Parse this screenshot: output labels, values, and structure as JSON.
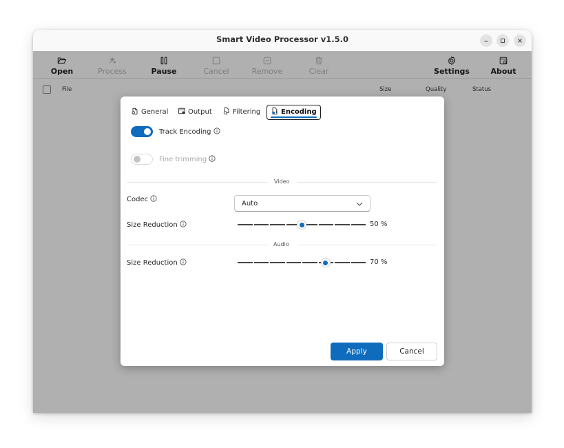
{
  "window": {
    "title": "Smart Video Processor v1.5.0"
  },
  "toolbar": {
    "items": [
      {
        "label": "Open",
        "icon": "folder-open-icon",
        "enabled": true
      },
      {
        "label": "Process",
        "icon": "process-icon",
        "enabled": false
      },
      {
        "label": "Pause",
        "icon": "pause-icon",
        "enabled": true
      },
      {
        "label": "Cancel",
        "icon": "stop-icon",
        "enabled": false
      },
      {
        "label": "Remove",
        "icon": "remove-icon",
        "enabled": false
      },
      {
        "label": "Clear",
        "icon": "trash-icon",
        "enabled": false
      },
      {
        "label": "Settings",
        "icon": "gear-icon",
        "enabled": true
      },
      {
        "label": "About",
        "icon": "about-icon",
        "enabled": true
      }
    ]
  },
  "file_list": {
    "columns": [
      "File",
      "Size",
      "Quality",
      "Status"
    ]
  },
  "dialog": {
    "tabs": [
      {
        "label": "General",
        "icon": "general-icon",
        "active": false
      },
      {
        "label": "Output",
        "icon": "output-icon",
        "active": false
      },
      {
        "label": "Filtering",
        "icon": "filtering-icon",
        "active": false
      },
      {
        "label": "Encoding",
        "icon": "encoding-icon",
        "active": true
      }
    ],
    "track_encoding": {
      "label": "Track Encoding",
      "on": true
    },
    "fine_trimming": {
      "label": "Fine trimming",
      "on": false,
      "enabled": false
    },
    "video_section": "Video",
    "codec": {
      "label": "Codec",
      "value": "Auto"
    },
    "video_size_reduction": {
      "label": "Size Reduction",
      "value": 50,
      "display": "50 %"
    },
    "audio_section": "Audio",
    "audio_size_reduction": {
      "label": "Size Reduction",
      "value": 70,
      "display": "70 %"
    },
    "apply_label": "Apply",
    "cancel_label": "Cancel"
  },
  "colors": {
    "accent": "#0f6cbd",
    "overlay": "rgba(0,0,0,0.31)"
  }
}
